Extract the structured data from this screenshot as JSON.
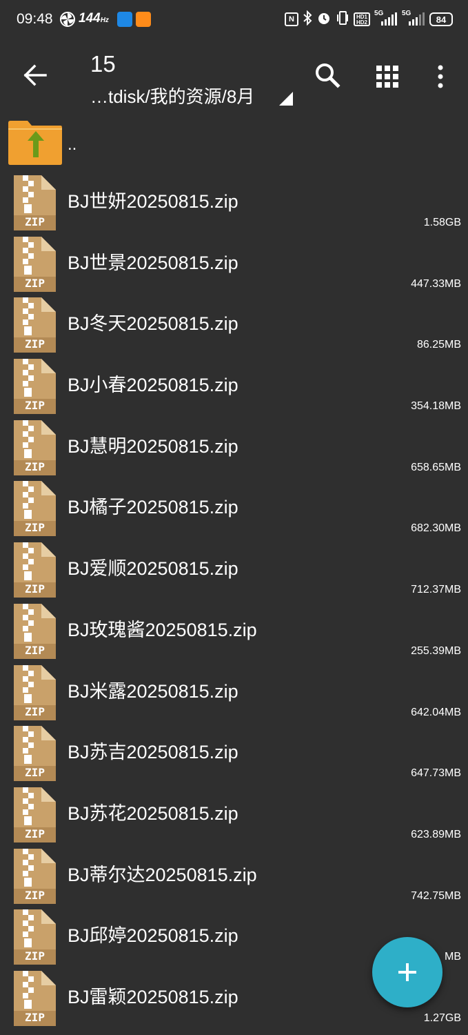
{
  "status_bar": {
    "time": "09:48",
    "refresh_rate": "144",
    "refresh_unit": "Hz",
    "hd1": "HD1",
    "hd2": "HD2",
    "net1": "5G",
    "net2": "5G",
    "battery": "84",
    "icons": [
      "pinwheel-icon",
      "app-icon",
      "app-icon",
      "nfc-icon",
      "bluetooth-icon",
      "alarm-icon",
      "vibrate-icon",
      "signal-icon",
      "battery-icon"
    ]
  },
  "toolbar": {
    "title": "15",
    "path": "…tdisk/我的资源/8月",
    "icons": [
      "back-arrow-icon",
      "search-icon",
      "grid-view-icon",
      "more-vertical-icon"
    ]
  },
  "parent": {
    "label": ".."
  },
  "files": [
    {
      "name": "BJ世妍20250815.zip",
      "size": "1.58GB"
    },
    {
      "name": "BJ世景20250815.zip",
      "size": "447.33MB"
    },
    {
      "name": "BJ冬天20250815.zip",
      "size": "86.25MB"
    },
    {
      "name": "BJ小春20250815.zip",
      "size": "354.18MB"
    },
    {
      "name": "BJ慧明20250815.zip",
      "size": "658.65MB"
    },
    {
      "name": "BJ橘子20250815.zip",
      "size": "682.30MB"
    },
    {
      "name": "BJ爱顺20250815.zip",
      "size": "712.37MB"
    },
    {
      "name": "BJ玫瑰酱20250815.zip",
      "size": "255.39MB"
    },
    {
      "name": "BJ米露20250815.zip",
      "size": "642.04MB"
    },
    {
      "name": "BJ苏吉20250815.zip",
      "size": "647.73MB"
    },
    {
      "name": "BJ苏花20250815.zip",
      "size": "623.89MB"
    },
    {
      "name": "BJ蒂尔达20250815.zip",
      "size": "742.75MB"
    },
    {
      "name": "BJ邱婷20250815.zip",
      "size": "MB"
    },
    {
      "name": "BJ雷颖20250815.zip",
      "size": "1.27GB"
    }
  ],
  "zip_label": "ZIP",
  "colors": {
    "background": "#2f2f2f",
    "fab": "#2eafc8",
    "zip_body": "#c9a16a",
    "folder": "#f0a030",
    "folder_arrow": "#6a9a1a"
  }
}
